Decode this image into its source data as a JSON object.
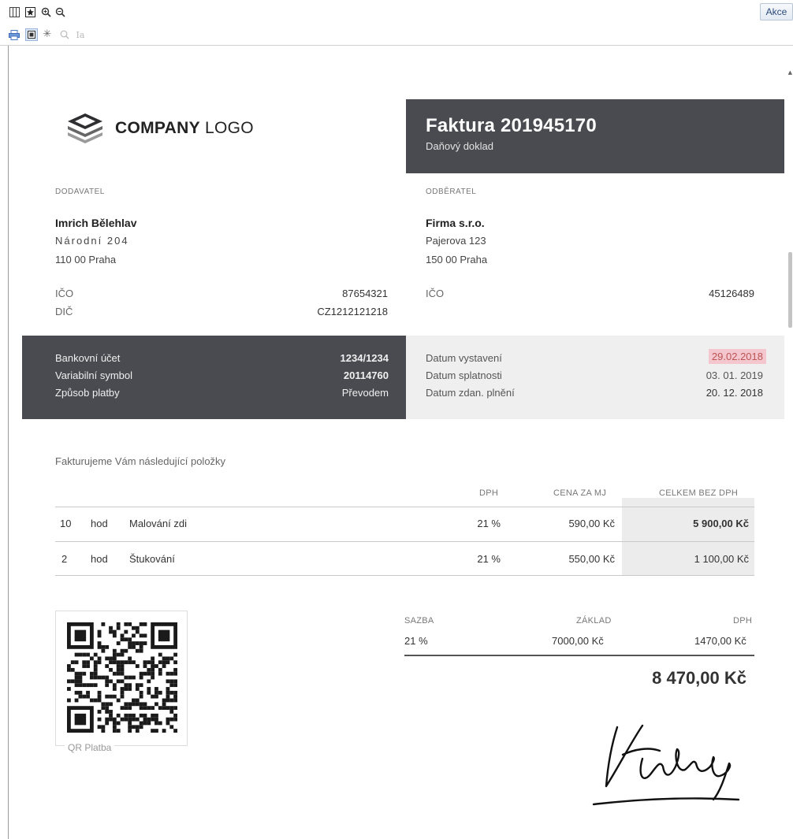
{
  "toolbar": {
    "akce_label": "Akce"
  },
  "invoice": {
    "logo": {
      "bold": "COMPANY",
      "light": " LOGO"
    },
    "title": "Faktura 201945170",
    "subtitle": "Daňový doklad",
    "supplier": {
      "label": "DODAVATEL",
      "name": "Imrich Bělehlav",
      "street": "Národní 204",
      "city": "110 00 Praha",
      "ico_label": "IČO",
      "ico": "87654321",
      "dic_label": "DIČ",
      "dic": "CZ1212121218"
    },
    "customer": {
      "label": "ODBĚRATEL",
      "name": "Firma s.r.o.",
      "street": "Pajerova 123",
      "city": "150 00 Praha",
      "ico_label": "IČO",
      "ico": "45126489"
    },
    "payment": {
      "account_label": "Bankovní účet",
      "account": "1234/1234",
      "vs_label": "Variabilní symbol",
      "vs": "20114760",
      "method_label": "Způsob platby",
      "method": "Převodem"
    },
    "dates": {
      "issued_label": "Datum vystavení",
      "issued": "29.02.2018",
      "due_label": "Datum splatnosti",
      "due": "03. 01. 2019",
      "taxable_label": "Datum zdan. plnění",
      "taxable": "20. 12. 2018"
    },
    "items_intro": "Fakturujeme Vám následující položky",
    "columns": {
      "vat": "DPH",
      "unit_price": "CENA ZA MJ",
      "total": "CELKEM BEZ DPH"
    },
    "items": [
      {
        "qty": "10",
        "unit": "hod",
        "desc": "Malování zdi",
        "vat": "21 %",
        "price": "590,00 Kč",
        "total": "5 900,00 Kč"
      },
      {
        "qty": "2",
        "unit": "hod",
        "desc": "Štukování",
        "vat": "21 %",
        "price": "550,00 Kč",
        "total": "1 100,00 Kč"
      }
    ],
    "summary": {
      "rate_label": "SAZBA",
      "base_label": "ZÁKLAD",
      "vat_label": "DPH",
      "rate": "21 %",
      "base": "7000,00 Kč",
      "vat": "1470,00 Kč",
      "grand_total": "8 470,00 Kč"
    },
    "qr_label": "QR Platba"
  }
}
